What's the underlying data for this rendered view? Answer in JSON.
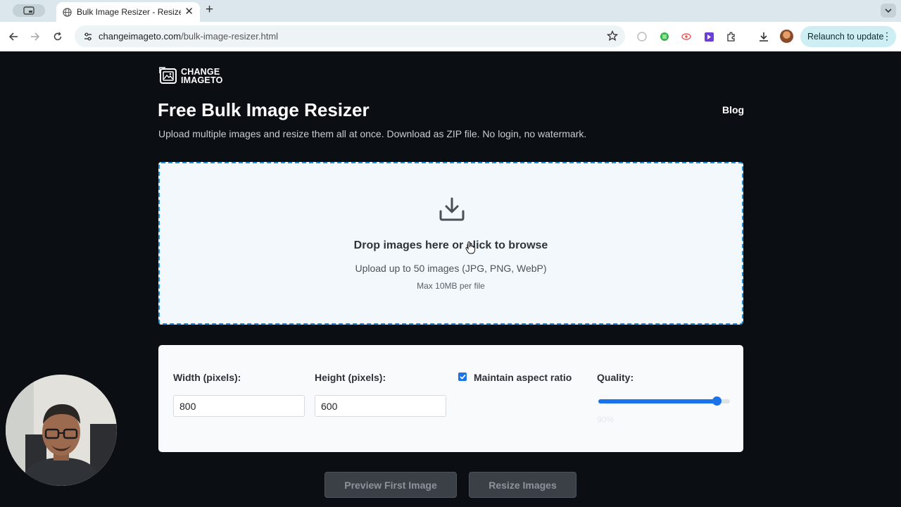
{
  "browser": {
    "tab_title": "Bulk Image Resizer - Resize M",
    "url_host": "changeimageto.com",
    "url_path": "/bulk-image-resizer.html",
    "relaunch_label": "Relaunch to update"
  },
  "header": {
    "logo_line1": "CHANGE",
    "logo_line2": "IMAGETO",
    "title": "Free Bulk Image Resizer",
    "blog_label": "Blog",
    "subtitle": "Upload multiple images and resize them all at once. Download as ZIP file. No login, no watermark."
  },
  "dropzone": {
    "title": "Drop images here or click to browse",
    "subtitle": "Upload up to 50 images (JPG, PNG, WebP)",
    "max": "Max 10MB per file"
  },
  "settings": {
    "width_label": "Width (pixels):",
    "width_value": "800",
    "height_label": "Height (pixels):",
    "height_value": "600",
    "aspect_label": "Maintain aspect ratio",
    "aspect_checked": true,
    "quality_label": "Quality:",
    "quality_value": "90%",
    "quality_fraction": 0.9
  },
  "actions": {
    "preview_label": "Preview First Image",
    "resize_label": "Resize Images"
  },
  "colors": {
    "accent": "#1a73e8",
    "page_bg": "#0b0e13",
    "dropzone_border": "#1e8fd8"
  }
}
